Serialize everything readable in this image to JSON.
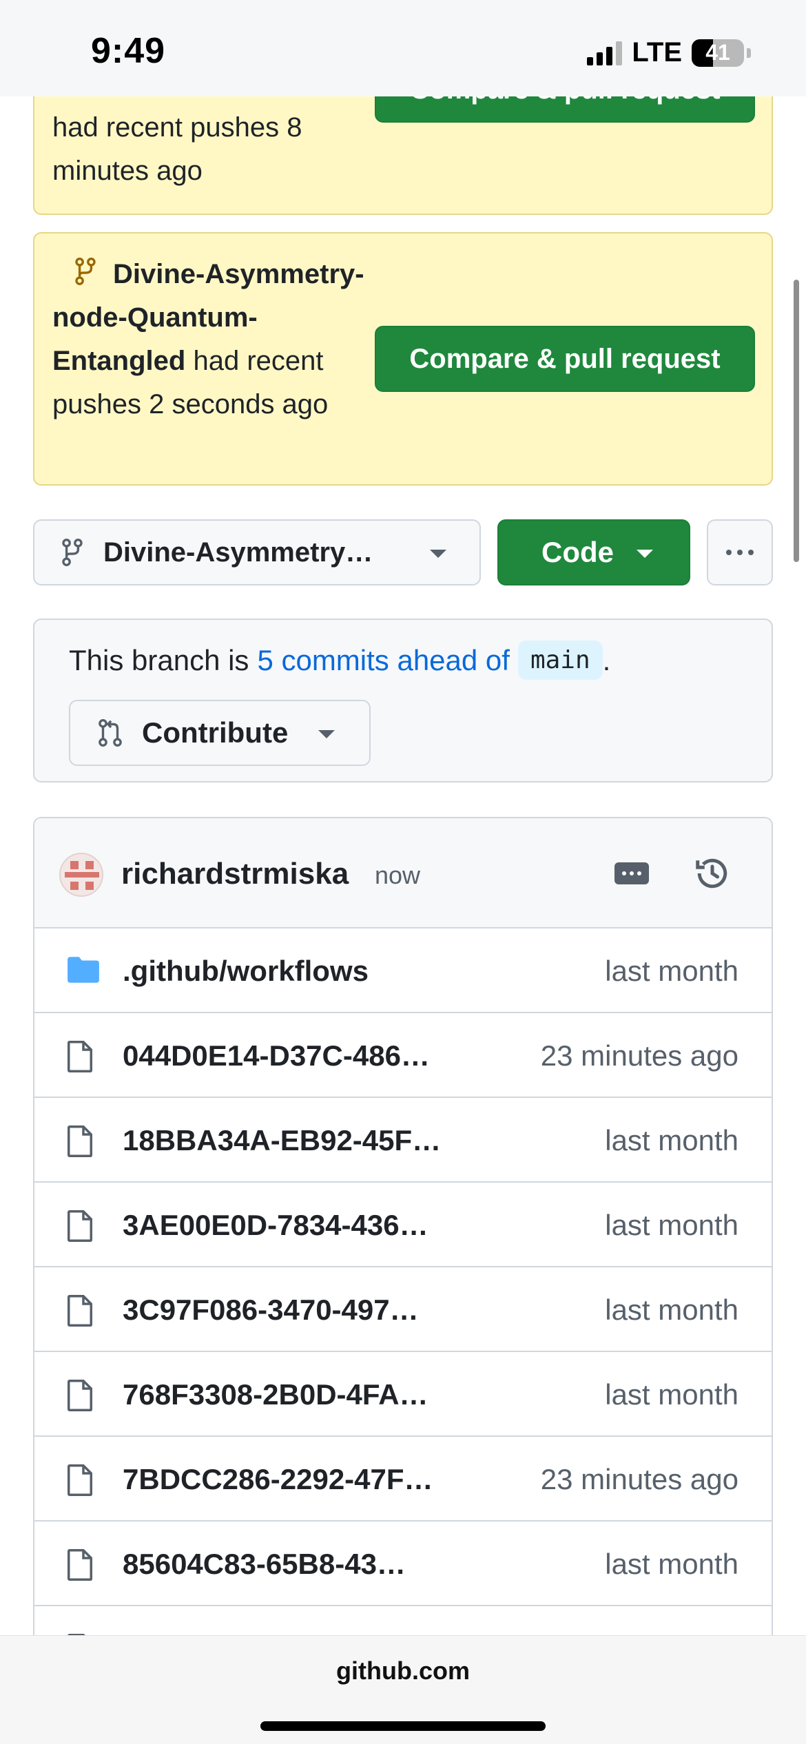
{
  "status_bar": {
    "time": "9:49",
    "network": "LTE",
    "battery": "41"
  },
  "banners": [
    {
      "branch": "",
      "text": "had recent pushes 8 minutes ago",
      "button_label": "Compare & pull request"
    },
    {
      "branch": "Divine-Asymmetry-node-Quantum-Entangled",
      "text": "had recent pushes 2 seconds ago",
      "button_label": "Compare & pull request"
    }
  ],
  "branch_selector": {
    "label": "Divine-Asymmetry…"
  },
  "code_button": {
    "label": "Code"
  },
  "ahead": {
    "prefix": "This branch is",
    "link": "5 commits ahead of",
    "ref": "main",
    "suffix": "."
  },
  "contribute": {
    "label": "Contribute"
  },
  "commit": {
    "author": "richardstrmiska",
    "time": "now"
  },
  "files": [
    {
      "name": ".github/workflows",
      "time": "last month",
      "type": "folder"
    },
    {
      "name": "044D0E14-D37C-486…",
      "time": "23 minutes ago",
      "type": "file"
    },
    {
      "name": "18BBA34A-EB92-45F…",
      "time": "last month",
      "type": "file"
    },
    {
      "name": "3AE00E0D-7834-436…",
      "time": "last month",
      "type": "file"
    },
    {
      "name": "3C97F086-3470-497…",
      "time": "last month",
      "type": "file"
    },
    {
      "name": "768F3308-2B0D-4FA…",
      "time": "last month",
      "type": "file"
    },
    {
      "name": "7BDCC286-2292-47F…",
      "time": "23 minutes ago",
      "type": "file"
    },
    {
      "name": "85604C83-65B8-43…",
      "time": "last month",
      "type": "file"
    }
  ],
  "browser": {
    "url": "github.com"
  },
  "colors": {
    "green": "#1f883d",
    "link": "#0969da",
    "banner": "#fff8c5",
    "border": "#d0d7de"
  }
}
